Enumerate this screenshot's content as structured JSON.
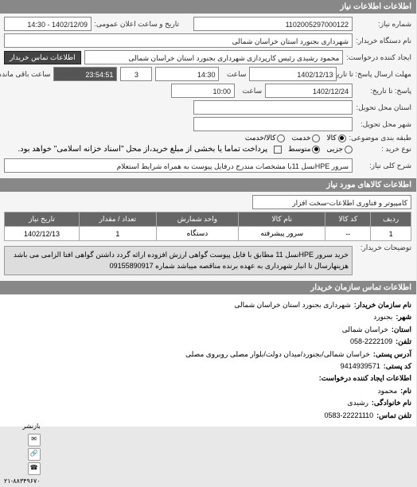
{
  "headers": {
    "need_info": "اطلاعات اطلاعات نیاز",
    "goods_info": "اطلاعات کالاهای مورد نیاز",
    "contact_info": "اطلاعات تماس سازمان خریدار"
  },
  "labels": {
    "req_number": "شماره نیاز:",
    "buyer_org": "نام دستگاه خریدار:",
    "requester": "ایجاد کننده درخواست:",
    "response_deadline": "مهلت ارسال پاسخ: تا تاریخ:",
    "answer_from": "پاسخ: تا تاریخ:",
    "delivery_loc": "استان محل تحویل:",
    "delivery_city": "شهر محل تحویل:",
    "subject_class": "طبقه بندی موضوعی:",
    "purchase_type": "نوع خرید : ",
    "need_title": "شرح کلی نیاز:",
    "pub_datetime": "تاریخ و ساعت اعلان عمومی:",
    "buyer_contact": "اطلاعات تماس خریدار",
    "time": "ساعت",
    "remaining": "ساعت باقی مانده",
    "buyer_desc": "توضیحات خریدار:"
  },
  "values": {
    "req_number": "1102005297000122",
    "buyer_org": "شهرداری بجنورد استان خراسان شمالی",
    "requester": "محمود رشیدی رئیس کارپردازی شهرداری بجنورد استان خراسان شمالی",
    "response_date": "1402/12/13",
    "response_time": "14:30",
    "response_days": "3",
    "countdown": "23:54:51",
    "answer_date": "1402/12/24",
    "answer_time": "10:00",
    "province": "",
    "city": "",
    "pub_datetime": "1402/12/09 - 14:30",
    "need_title": "سرور HPEنسل 11با مشخصات مندرج درفایل پیوست به همراه شرایط استعلام",
    "category": "کامپیوتر و فناوری اطلاعات-سخت افزار",
    "buyer_desc": "خرید سرور HPEنسل 11 مطابق با فایل پیوست گواهی ارزش افزوده ارائه گردد داشتن گواهی افتا الزامی می باشد هزینهارسال تا انبار شهرداری به عهده برنده مناقصه میباشد شماره 09155890917"
  },
  "radios": {
    "class": {
      "goods": "کالا",
      "service": "خدمت",
      "both": "کالا/خدمت"
    },
    "ptype": {
      "small": "جزیی",
      "medium": "متوسط",
      "note": "پرداخت تماما یا بخشی از مبلغ خرید،از محل \"اسناد خزانه اسلامی\" خواهد بود."
    }
  },
  "table": {
    "headers": [
      "ردیف",
      "کد کالا",
      "نام کالا",
      "واحد شمارش",
      "تعداد / مقدار",
      "تاریخ نیاز"
    ],
    "rows": [
      {
        "idx": "1",
        "code": "--",
        "name": "سرور پیشرفته",
        "unit": "دستگاه",
        "qty": "1",
        "date": "1402/12/13"
      }
    ]
  },
  "contact": {
    "org_label": "نام سازمان خریدار:",
    "org": "شهرداری بجنورد استان خراسان شمالی",
    "city_label": "شهر:",
    "city": "بجنورد",
    "province_label": "استان:",
    "province": "خراسان شمالی",
    "phone_label": "تلفن:",
    "phone": "058-2222109",
    "address_label": "آدرس پستی:",
    "address": "خراسان شمالی/بجنورد/میدان دولت/بلوار مصلی روبروی مصلی",
    "postal_label": "کد پستی:",
    "postal": "9414939571",
    "name_label": "نام:",
    "name": "محمود",
    "family_label": "نام خانوادگی:",
    "family": "رشیدی",
    "contact_phone_label": "تلفن تماس:",
    "contact_phone": "0583-22221110",
    "req_creator_label": "اطلاعات ایجاد کننده درخواست:",
    "share_label": "بازنشر"
  },
  "share_phone": "۲۱-۸۸۳۴۹۶۷۰"
}
